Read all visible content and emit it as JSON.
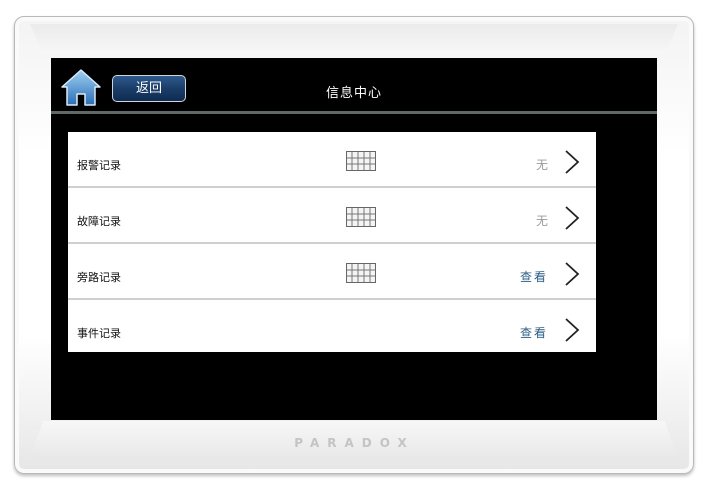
{
  "header": {
    "back_label": "返回",
    "title": "信息中心"
  },
  "brand": "PARADOX",
  "records": [
    {
      "label": "报警记录",
      "value": "无",
      "has_grid_icon": true
    },
    {
      "label": "故障记录",
      "value": "无",
      "has_grid_icon": true
    },
    {
      "label": "旁路记录",
      "value": "查看",
      "has_grid_icon": true
    },
    {
      "label": "事件记录",
      "value": "查看",
      "has_grid_icon": false
    }
  ],
  "colors": {
    "screen_bg": "#000000",
    "back_button": "#1a3d68",
    "view_text": "#2d5e86",
    "none_text": "#9a9a9a",
    "home_icon": "#4a90d0"
  },
  "icons": [
    "home-icon",
    "grid-icon",
    "chevron-right-icon"
  ]
}
